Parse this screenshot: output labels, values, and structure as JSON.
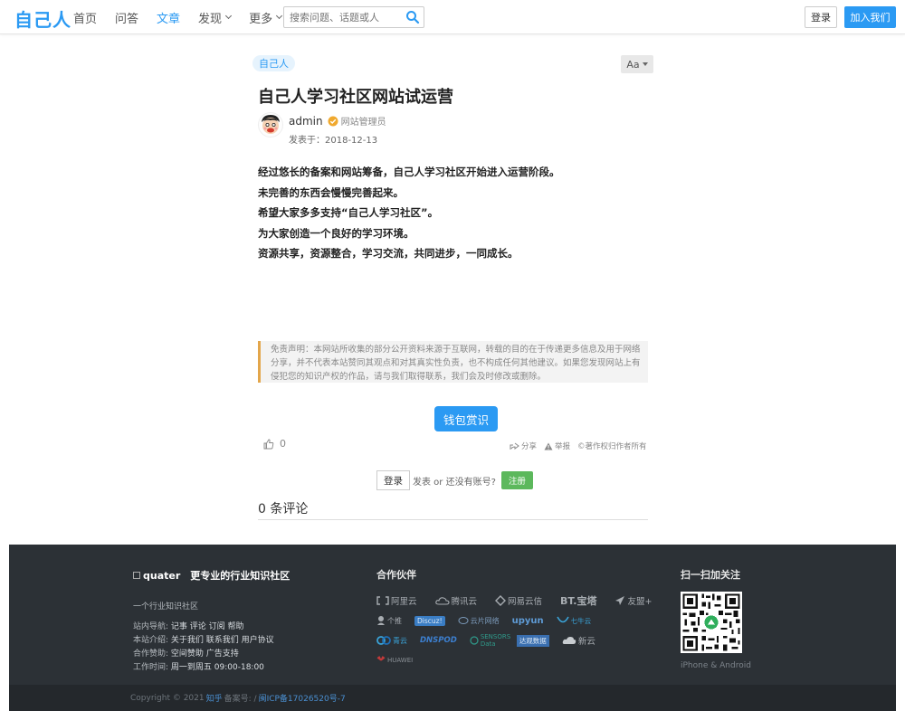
{
  "header": {
    "logo": "自己人",
    "nav": [
      {
        "label": "首页",
        "active": false,
        "dropdown": false
      },
      {
        "label": "问答",
        "active": false,
        "dropdown": false
      },
      {
        "label": "文章",
        "active": true,
        "dropdown": false
      },
      {
        "label": "发现",
        "active": false,
        "dropdown": true
      },
      {
        "label": "更多",
        "active": false,
        "dropdown": true
      }
    ],
    "search_placeholder": "搜索问题、话题或人",
    "login": "登录",
    "join": "加入我们"
  },
  "article": {
    "tag": "自己人",
    "font_toggle": "Aa",
    "title": "自己人学习社区网站试运营",
    "author": "admin",
    "author_role": "网站管理员",
    "published": "发表于：2018-12-13",
    "paragraphs": [
      "经过悠长的备案和网站筹备，自己人学习社区开始进入运营阶段。",
      "未完善的东西会慢慢完善起来。",
      "希望大家多多支持“自己人学习社区”。",
      "为大家创造一个良好的学习环境。",
      "资源共享，资源整合，学习交流，共同进步，一同成长。"
    ],
    "disclaimer": "免责声明：本网站所收集的部分公开资料来源于互联网，转载的目的在于传递更多信息及用于网络分享，并不代表本站赞同其观点和对其真实性负责，也不构成任何其他建议。如果您发现网站上有侵犯您的知识产权的作品，请与我们取得联系，我们会及时修改或删除。",
    "reward": "钱包赏识",
    "likes": "0",
    "share": "分享",
    "report": "举报",
    "copyright": "©著作权归作者所有"
  },
  "comment_bar": {
    "login": "登录",
    "text": "发表 or 还没有账号?",
    "register": "注册",
    "count": "0 条评论"
  },
  "footer": {
    "brand_img_alt": "quater",
    "brand_slogan": "更专业的行业知识社区",
    "tagline": "一个行业知识社区",
    "links": [
      {
        "label": "站内导航:",
        "value": "记事 评论 订阅 帮助"
      },
      {
        "label": "本站介绍:",
        "value": "关于我们 联系我们 用户协议"
      },
      {
        "label": "合作赞助:",
        "value": "空间赞助 广告支持"
      },
      {
        "label": "工作时间:",
        "value": "周一到周五 09:00-18:00"
      }
    ],
    "partners_title": "合作伙伴",
    "partners": [
      [
        "阿里云",
        "腾讯云",
        "网易云信",
        "BT.宝塔",
        "友盟+"
      ],
      [
        "个推",
        "Discuz!",
        "云片网络",
        "upyun",
        "七牛云"
      ],
      [
        "青云",
        "DNSPOD",
        "SENSORS Data",
        "达观数据",
        "新云"
      ],
      [
        "HUAWEI"
      ]
    ],
    "follow_title": "扫一扫加关注",
    "qr_caption": "iPhone & Android",
    "copyright": "Copyright © 2021",
    "copyright_link": "知乎",
    "icp_label": "备案号: /",
    "icp": "闽ICP备17026520号-7"
  },
  "colors": {
    "primary": "#2b9af3",
    "success": "#5cb85c",
    "footer_bg": "#2c3136",
    "disclaimer_border": "#e3a64b"
  }
}
